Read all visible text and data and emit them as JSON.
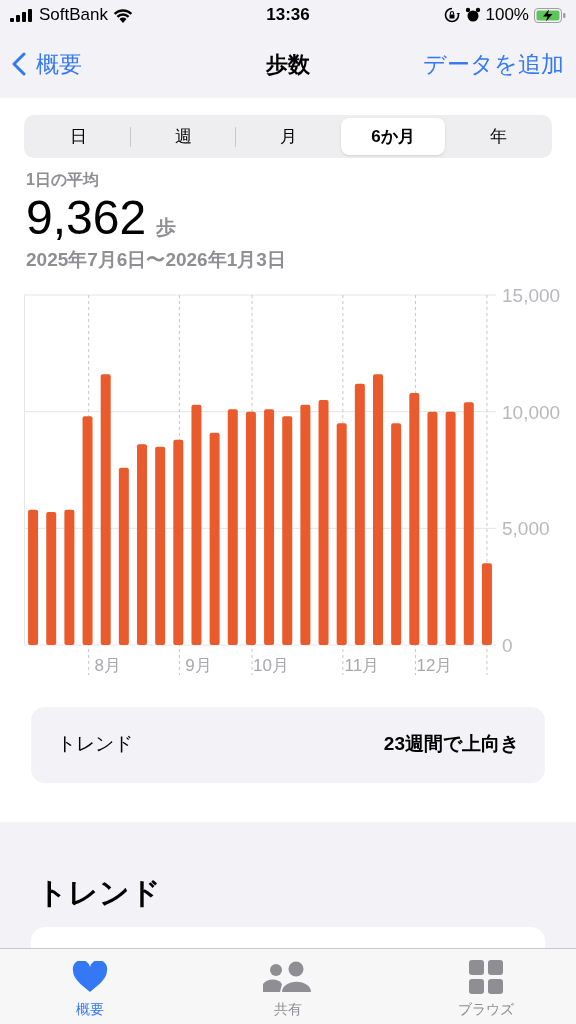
{
  "status_bar": {
    "carrier": "SoftBank",
    "time": "13:36",
    "battery": "100%"
  },
  "nav": {
    "back": "概要",
    "title": "歩数",
    "action": "データを追加"
  },
  "segments": [
    {
      "label": "日",
      "selected": false
    },
    {
      "label": "週",
      "selected": false
    },
    {
      "label": "月",
      "selected": false
    },
    {
      "label": "6か月",
      "selected": true
    },
    {
      "label": "年",
      "selected": false
    }
  ],
  "summary": {
    "label": "1日の平均",
    "value": "9,362",
    "unit": "歩",
    "range": "2025年7月6日〜2026年1月3日"
  },
  "chart": {
    "chart_data": {
      "type": "bar",
      "categories": [
        null,
        null,
        null,
        null,
        "8月",
        null,
        null,
        null,
        null,
        "9月",
        null,
        null,
        null,
        "10月",
        null,
        null,
        null,
        null,
        "11月",
        null,
        null,
        null,
        "12月",
        null,
        null,
        null
      ],
      "series": [
        {
          "color": "#e95a2c",
          "values": [
            5800,
            5700,
            5800,
            9800,
            11600,
            7600,
            8600,
            8500,
            8800,
            10300,
            9100,
            10100,
            10000,
            10100,
            9800,
            10300,
            10500,
            9500,
            11200,
            11600,
            9500,
            10800,
            10000,
            10000,
            10400,
            3500
          ]
        }
      ],
      "ylim": [
        0,
        15000
      ],
      "grid": true,
      "yticks": [
        {
          "value": 0,
          "label": "0"
        },
        {
          "value": 5000,
          "label": "5,000"
        },
        {
          "value": 10000,
          "label": "10,000"
        },
        {
          "value": 15000,
          "label": "15,000"
        }
      ]
    }
  },
  "trend_row": {
    "label": "トレンド",
    "value": "23週間で上向き"
  },
  "trend_section": {
    "title": "トレンド"
  },
  "tab_bar": [
    {
      "label": "概要",
      "kind": "heart",
      "selected": true
    },
    {
      "label": "共有",
      "kind": "people",
      "selected": false
    },
    {
      "label": "ブラウズ",
      "kind": "grid",
      "selected": false
    }
  ]
}
